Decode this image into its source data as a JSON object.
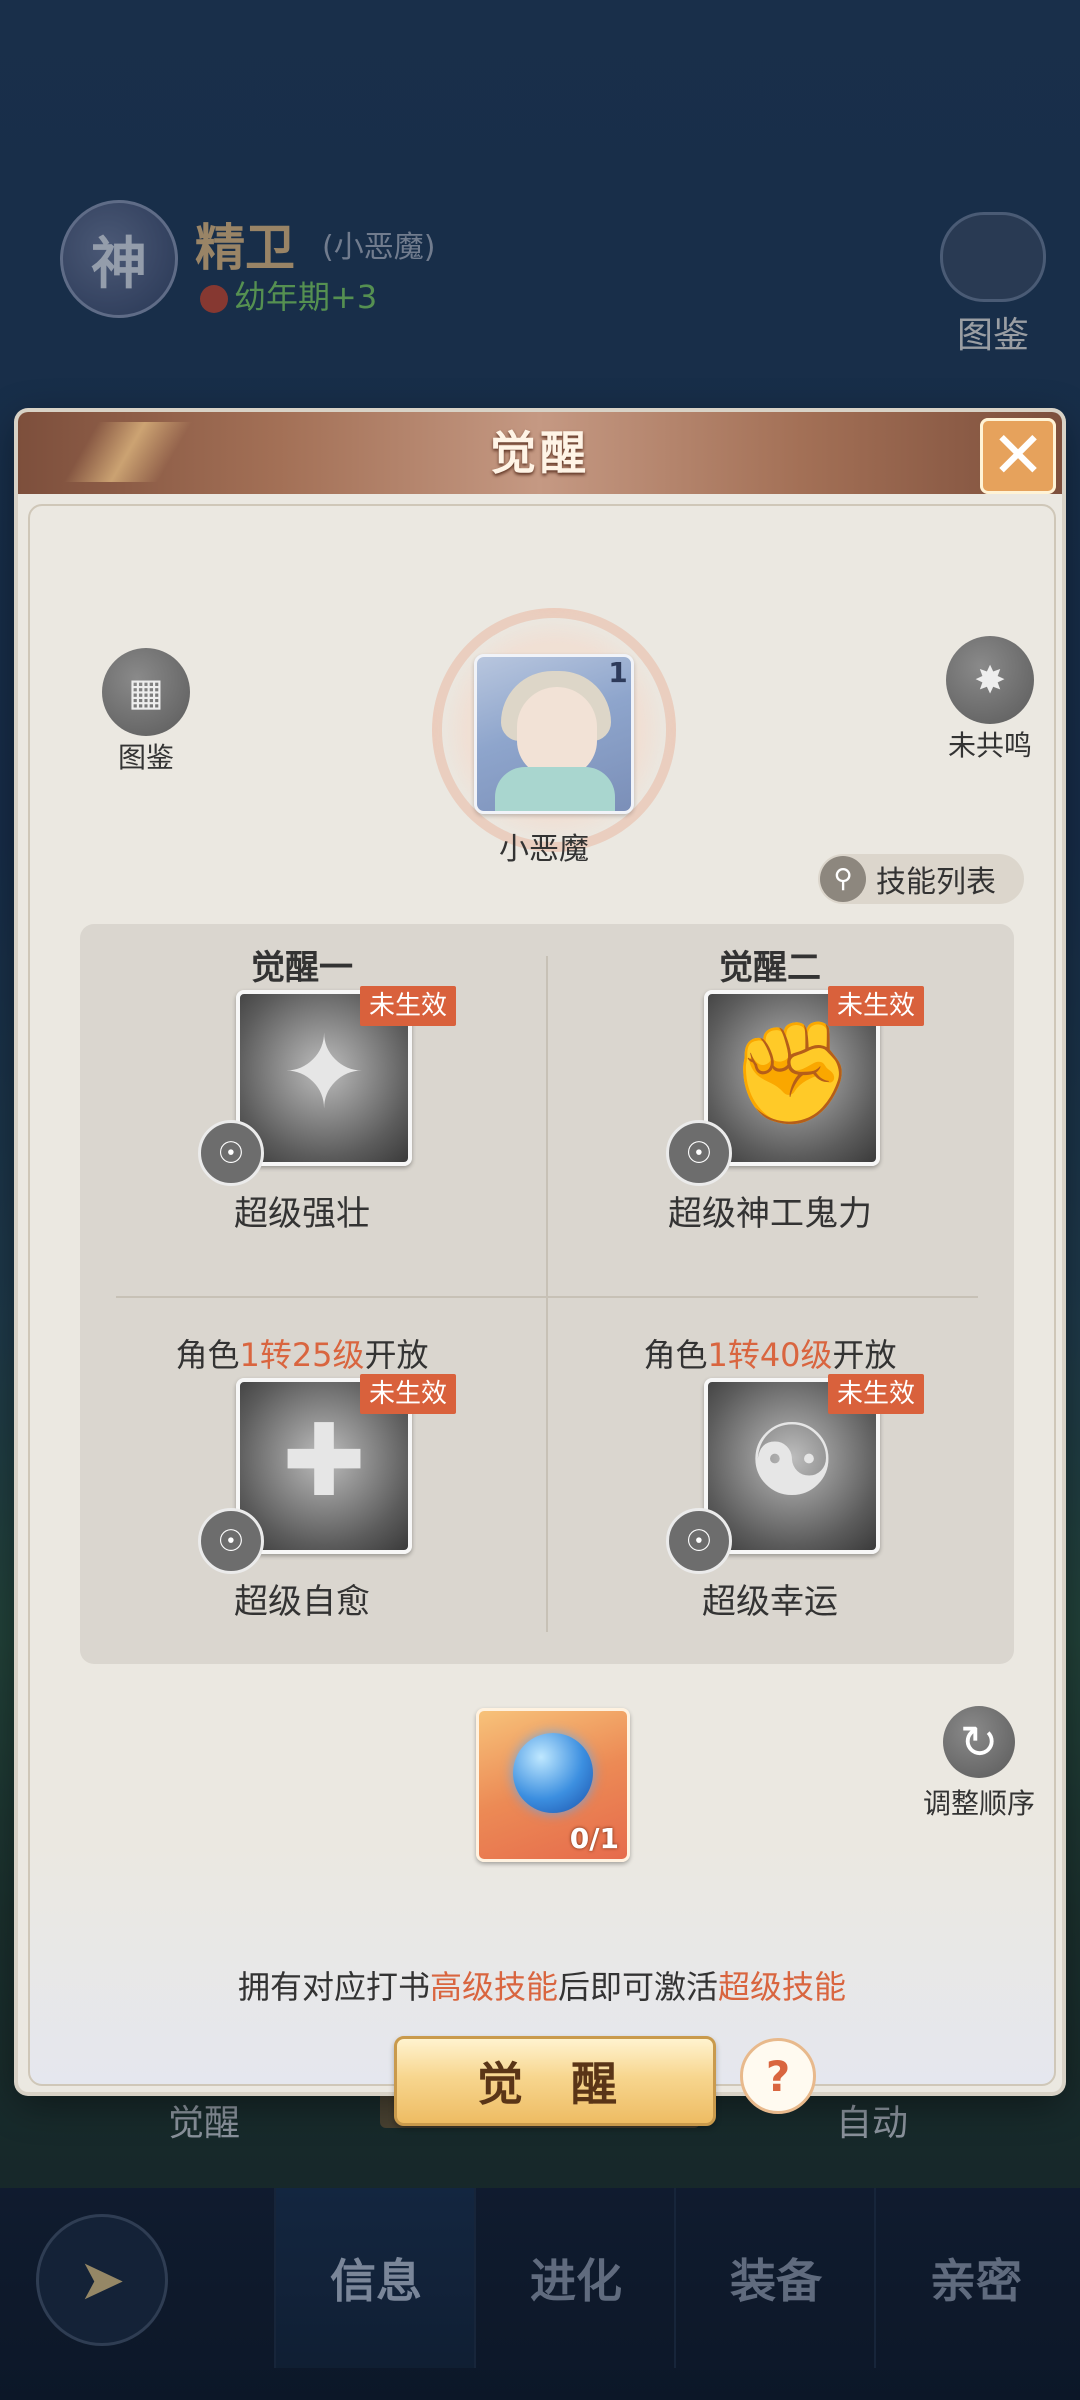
{
  "background": {
    "rank_badge": "神",
    "pet_name": "精卫",
    "pet_type": "(小恶魔)",
    "stage": "幼年期+3",
    "codex_label": "图鉴",
    "left_label": "觉醒",
    "right_label": "自动",
    "nav_tabs": [
      {
        "label": "信息",
        "active": true
      },
      {
        "label": "进化",
        "active": false
      },
      {
        "label": "装备",
        "active": false
      },
      {
        "label": "亲密",
        "active": false
      }
    ]
  },
  "dialog": {
    "title": "觉醒",
    "close_icon": "close-icon",
    "codex_label": "图鉴",
    "resonance_label": "未共鸣",
    "pet": {
      "name": "小恶魔",
      "level": "1"
    },
    "skill_list_label": "技能列表",
    "skills": [
      {
        "heading": "觉醒一",
        "status": "未生效",
        "name": "超级强壮",
        "icon": "muscle-icon"
      },
      {
        "heading": "觉醒二",
        "status": "未生效",
        "name": "超级神工鬼力",
        "icon": "fist-icon"
      },
      {
        "req_prefix": "角色",
        "req_hl": "1转25级",
        "req_suffix": "开放",
        "status": "未生效",
        "name": "超级自愈",
        "icon": "heal-cross-icon"
      },
      {
        "req_prefix": "角色",
        "req_hl": "1转40级",
        "req_suffix": "开放",
        "status": "未生效",
        "name": "超级幸运",
        "icon": "koi-icon"
      }
    ],
    "item": {
      "count": "0/1"
    },
    "reorder_label": "调整顺序",
    "hint": {
      "part1": "拥有对应打书",
      "hl1": "高级技能",
      "part2": "后即可激活",
      "hl2": "超级技能"
    },
    "awaken_button": "觉 醒",
    "help_label": "?"
  },
  "colors": {
    "accent": "#d9653f",
    "header": "#a37056",
    "button_gold": "#f7d68f"
  }
}
